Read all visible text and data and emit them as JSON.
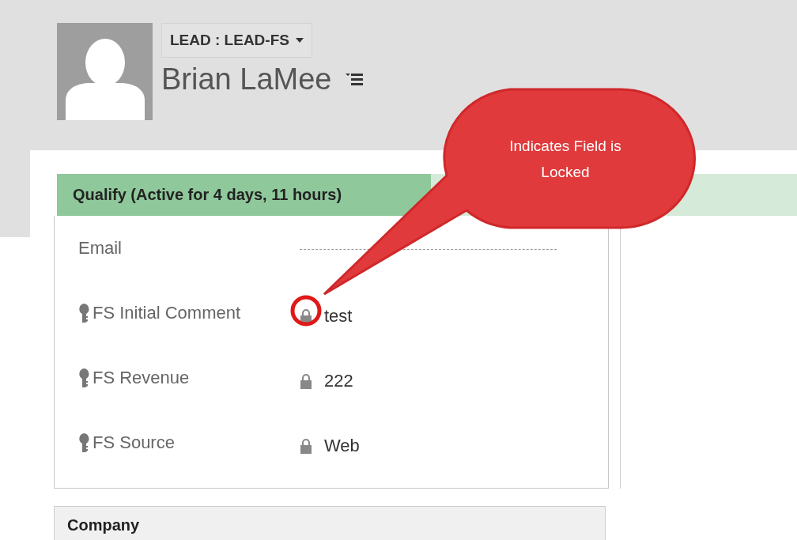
{
  "header": {
    "entity_selector": "LEAD : LEAD-FS",
    "name": "Brian LaMee"
  },
  "stage_bar": {
    "label": "Qualify (Active for 4 days, 11 hours)",
    "active": true
  },
  "fields": [
    {
      "label": "Email",
      "secured": false,
      "locked": false,
      "kind": "empty"
    },
    {
      "label": "FS Initial Comment",
      "secured": true,
      "locked": true,
      "kind": "text",
      "value": "test"
    },
    {
      "label": "FS Revenue",
      "secured": true,
      "locked": true,
      "kind": "text",
      "value": "222"
    },
    {
      "label": "FS Source",
      "secured": true,
      "locked": true,
      "kind": "text",
      "value": "Web"
    }
  ],
  "section": {
    "title": "Company"
  },
  "callout": {
    "text": "Indicates Field is Locked"
  }
}
